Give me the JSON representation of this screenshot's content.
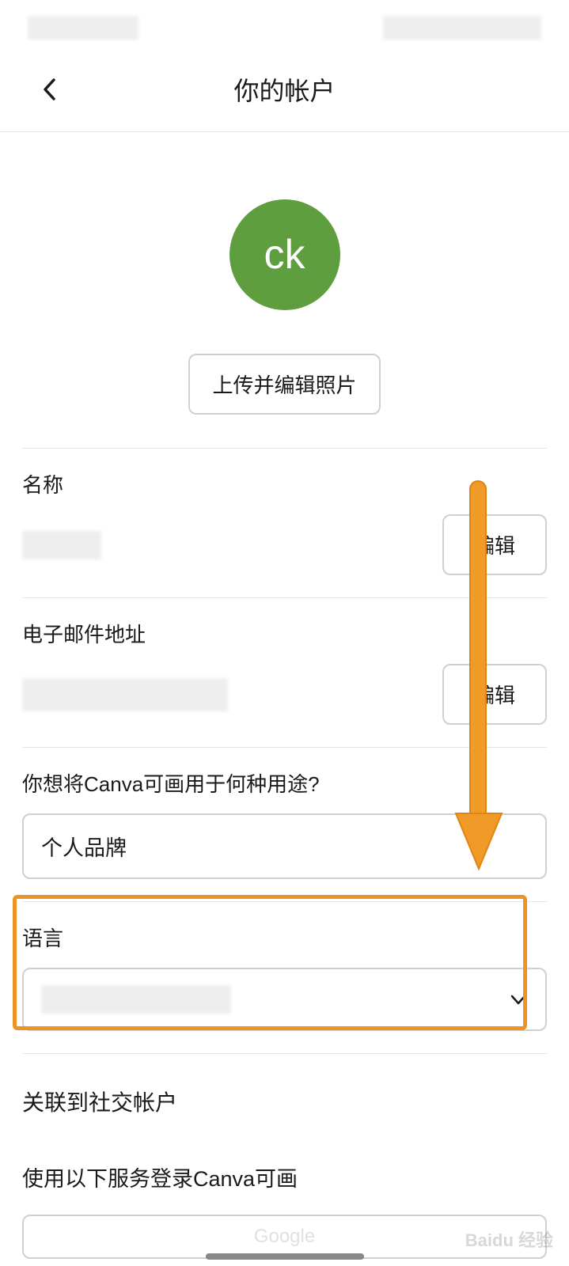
{
  "header": {
    "title": "你的帐户"
  },
  "avatar": {
    "initials": "ck",
    "upload_button": "上传并编辑照片"
  },
  "fields": {
    "name_label": "名称",
    "edit_button": "编辑",
    "email_label": "电子邮件地址",
    "usage_label": "你想将Canva可画用于何种用途?",
    "usage_value": "个人品牌",
    "language_label": "语言"
  },
  "social": {
    "title": "关联到社交帐户",
    "subtitle": "使用以下服务登录Canva可画",
    "google": "Google"
  },
  "watermark": "Baidu 经验"
}
